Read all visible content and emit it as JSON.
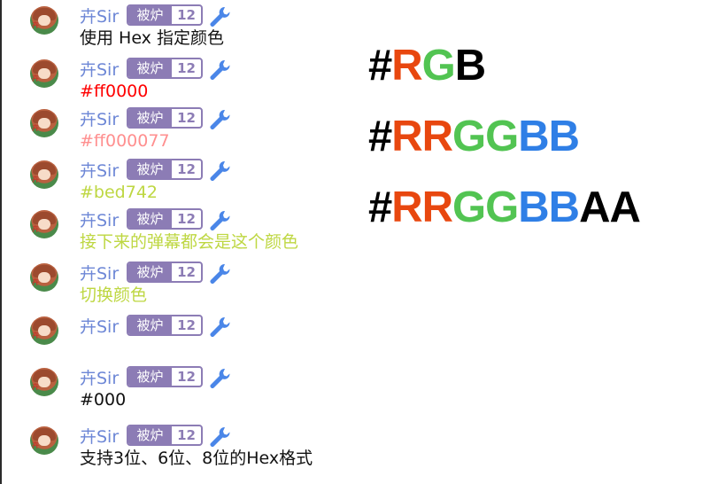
{
  "user": {
    "name": "卉Sir",
    "medal_name": "被炉",
    "medal_level": "12",
    "avatar_tag": "卉"
  },
  "colors": {
    "username": "#6d87d6",
    "medal": "#8c7cb5",
    "wrench": "#4a86e8",
    "legend_r": "#e8470f",
    "legend_g": "#52c452",
    "legend_b": "#2f7fe6",
    "legend_a": "#000000"
  },
  "messages": [
    {
      "text": "使用 Hex 指定颜色",
      "color": "#111111"
    },
    {
      "text": "#ff0000",
      "color": "#ff0000"
    },
    {
      "text": "#ff000077",
      "color": "#ff8f8f"
    },
    {
      "text": "#bed742",
      "color": "#bed742"
    },
    {
      "text": "接下来的弹幕都会是这个颜色",
      "color": "#bed742"
    },
    {
      "text": "切换颜色",
      "color": "#bed742"
    },
    {
      "text": "",
      "color": "#111111"
    },
    {
      "text": "#000",
      "color": "#111111"
    },
    {
      "text": "支持3位、6位、8位的Hex格式",
      "color": "#111111"
    }
  ],
  "legend": [
    [
      {
        "t": "#",
        "c": "#000000"
      },
      {
        "t": "R",
        "c": "#e8470f"
      },
      {
        "t": "G",
        "c": "#52c452"
      },
      {
        "t": "B",
        "c": "#000000"
      }
    ],
    [
      {
        "t": "#",
        "c": "#000000"
      },
      {
        "t": "RR",
        "c": "#e8470f"
      },
      {
        "t": "GG",
        "c": "#52c452"
      },
      {
        "t": "BB",
        "c": "#2f7fe6"
      }
    ],
    [
      {
        "t": "#",
        "c": "#000000"
      },
      {
        "t": "RR",
        "c": "#e8470f"
      },
      {
        "t": "GG",
        "c": "#52c452"
      },
      {
        "t": "BB",
        "c": "#2f7fe6"
      },
      {
        "t": "AA",
        "c": "#000000"
      }
    ]
  ]
}
